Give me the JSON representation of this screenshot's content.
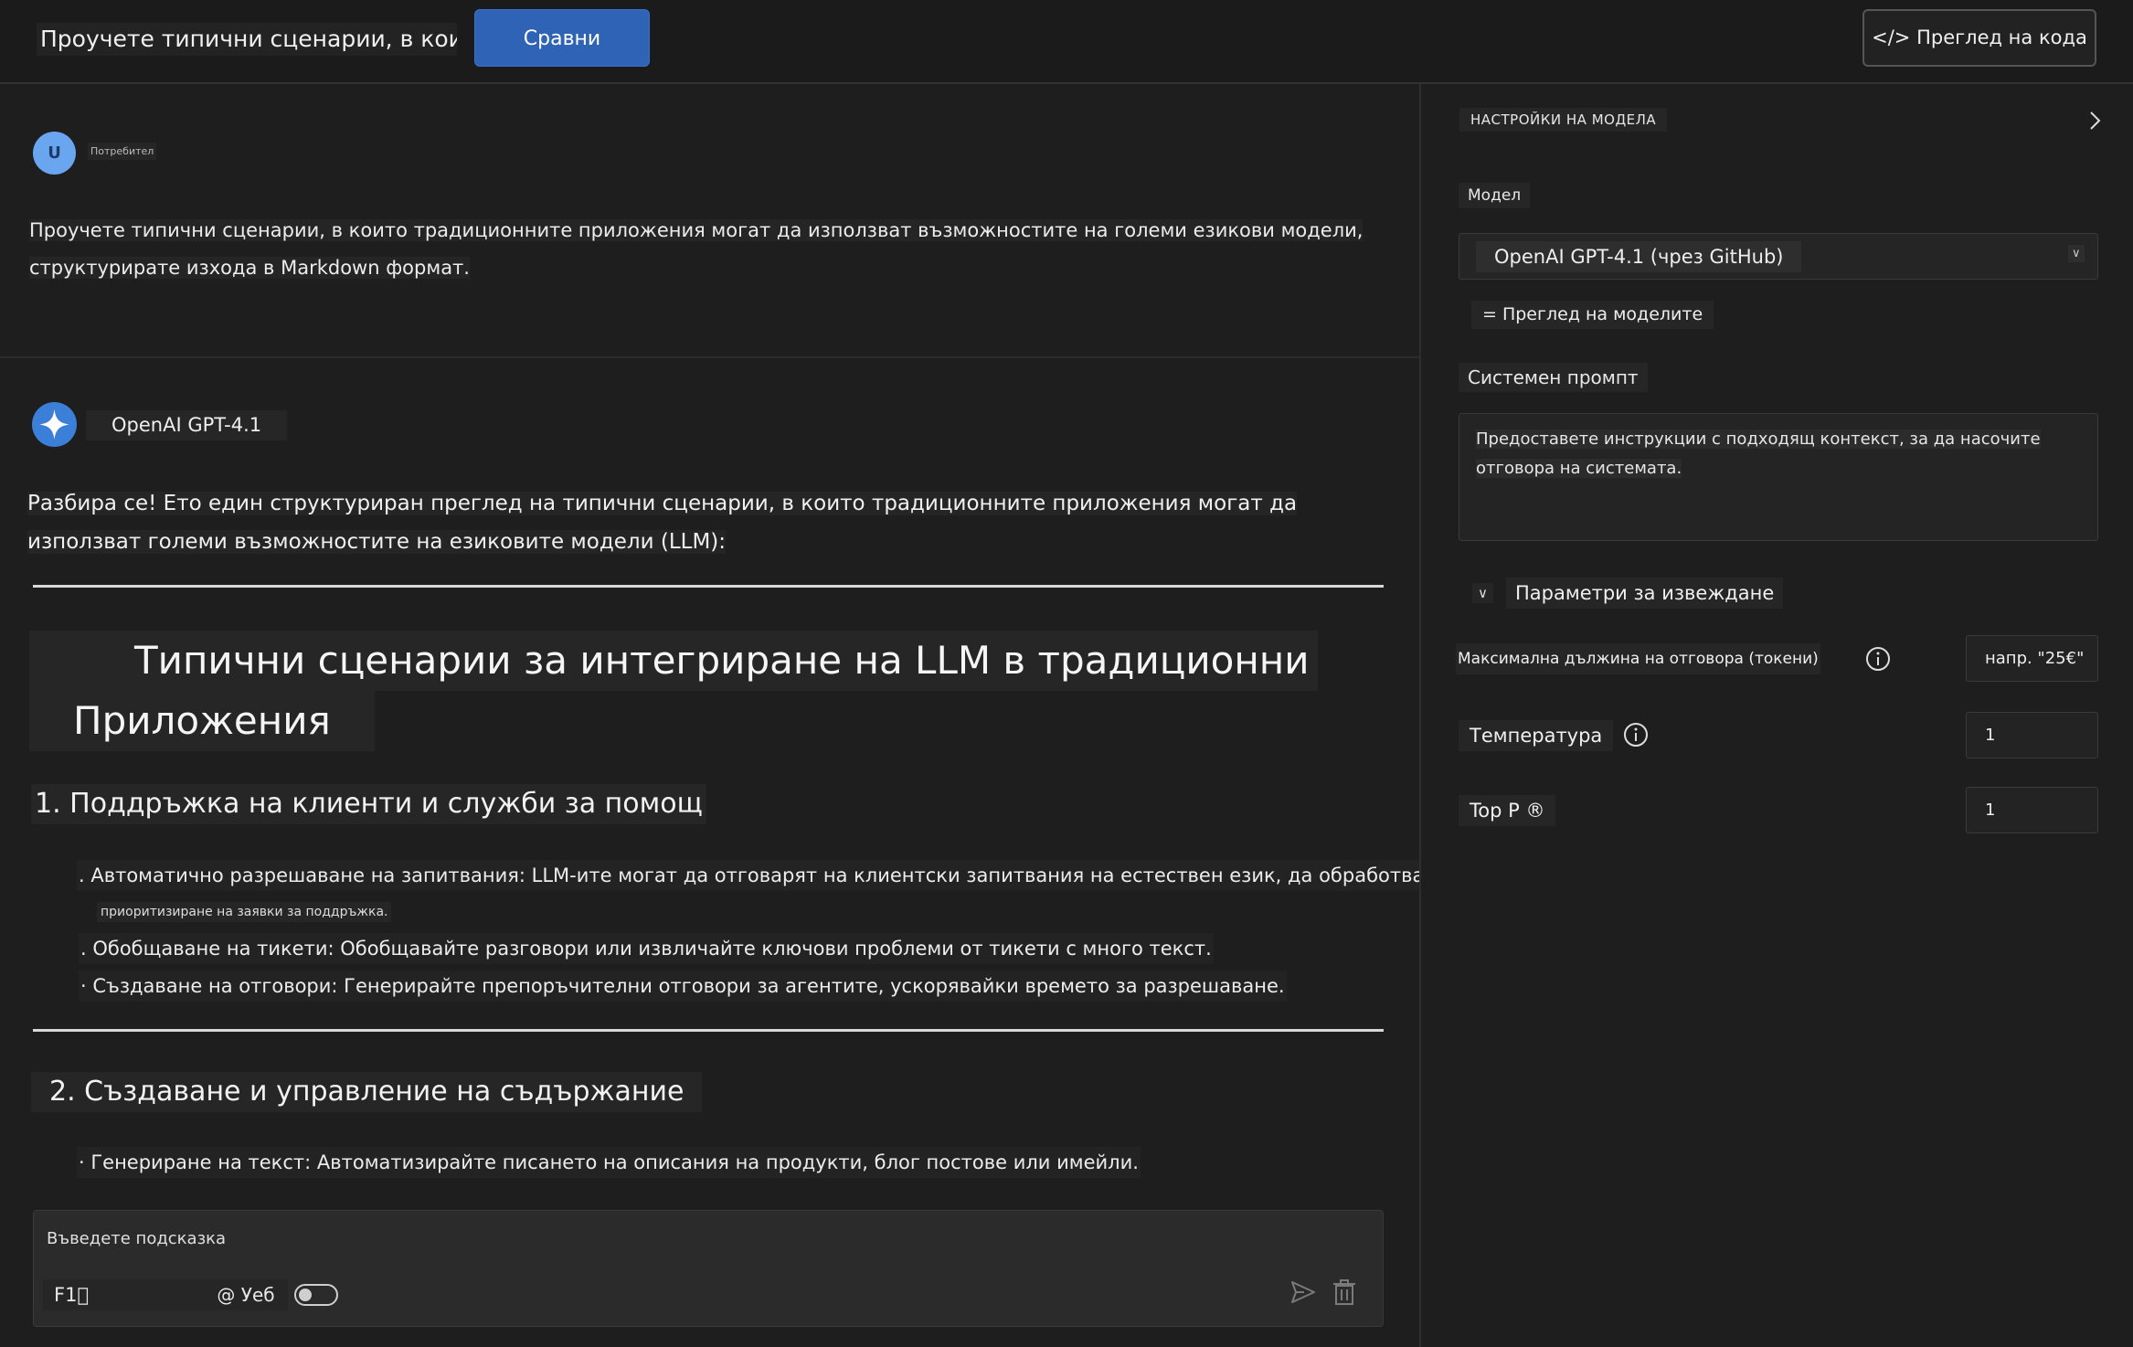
{
  "header": {
    "conversation_title": "Проучете типични сценарии, в които ...",
    "compare_button": "Сравни",
    "view_code_button": "</> Преглед на кода"
  },
  "chat": {
    "user": {
      "avatar_letter": "U",
      "name": "Потребител",
      "message": "Проучете типични сценарии, в които традиционните приложения могат да използват възможностите на големи езикови модели, структурирате изхода в Markdown формат."
    },
    "assistant": {
      "name": "OpenAI GPT-4.1",
      "intro": "Разбира се! Ето един структуриран преглед на типични сценарии, в които традиционните приложения могат да използват големи възможностите на езиковите модели (LLM):",
      "heading_line1": "Типични сценарии за интегриране на LLM в традиционни",
      "heading_line2": "Приложения",
      "section1_title": "1. Поддръжка на клиенти и служби за помощ",
      "section1_bullet1": ". Автоматично разрешаване на запитвания: LLM-ите могат да отговарят на клиентски запитвания на естествен език, да обработват ЧЗВ и",
      "section1_bullet1_cont": "приоритизиране на заявки за поддръжка.",
      "section1_bullet2": ". Обобщаване на тикети: Обобщавайте разговори или извличайте ключови проблеми от тикети с много текст.",
      "section1_bullet3": "· Създаване на отговори: Генерирайте препоръчителни отговори за агентите, ускорявайки времето за разрешаване.",
      "section2_title": "2. Създаване и управление на съдържание",
      "section2_bullet1": "· Генериране на текст: Автоматизирайте писането на описания на продукти, блог постове или имейли."
    },
    "input": {
      "placeholder": "Въведете подсказка",
      "f1_value": "F1⃞",
      "web_label": "@ Уеб",
      "web_toggle_on": false
    }
  },
  "settings": {
    "title": "НАСТРОЙКИ НА МОДЕЛА",
    "model_label": "Модел",
    "model_value": "OpenAI GPT-4.1 (чрез GitHub)",
    "model_caret": "∨",
    "browse_models": "= Преглед на моделите",
    "system_prompt_label": "Системен промпт",
    "system_prompt_placeholder": "Предоставете инструкции с подходящ контекст, за да насочите отговора на системата.",
    "output_params_caret": "∨",
    "output_params_title": "Параметри за извеждане",
    "max_tokens_label": "Максимална дължина на отговора (токени)",
    "max_tokens_value": "напр. \"25€\"",
    "temperature_label": "Температура",
    "temperature_value": "1",
    "top_p_label": "Top P ®",
    "top_p_value": "1"
  },
  "colors": {
    "background": "#1e1e1e",
    "accent_button": "#2f63b5",
    "user_avatar": "#6aa6f0",
    "assistant_avatar": "#3c7fd8"
  },
  "icons": [
    "sparkle-icon",
    "chevron-right-icon",
    "info-icon",
    "send-icon",
    "trash-icon"
  ]
}
